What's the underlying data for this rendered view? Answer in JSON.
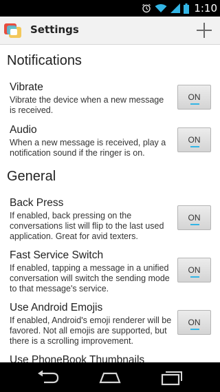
{
  "status_bar": {
    "time": "1:10",
    "icons": [
      "alarm-icon",
      "wifi-icon",
      "signal-icon",
      "battery-icon"
    ]
  },
  "action_bar": {
    "title": "Settings",
    "add_icon": "plus-icon"
  },
  "sections": [
    {
      "header": "Notifications",
      "items": [
        {
          "title": "Vibrate",
          "summary": "Vibrate the device when a new message is received.",
          "toggle": "ON"
        },
        {
          "title": "Audio",
          "summary": "When a new message is received, play a notification sound if the ringer is on.",
          "toggle": "ON"
        }
      ]
    },
    {
      "header": "General",
      "items": [
        {
          "title": "Back Press",
          "summary": "If enabled, back pressing on the conversations list will flip to the last used application. Great for avid texters.",
          "toggle": "ON"
        },
        {
          "title": "Fast Service Switch",
          "summary": "If enabled, tapping a message in a unified conversation will switch the sending mode to that message's service.",
          "toggle": "ON"
        },
        {
          "title": "Use Android Emojis",
          "summary": "If enabled, Android's emoji renderer will be favored. Not all emojis are supported, but there is a scrolling improvement.",
          "toggle": "ON"
        },
        {
          "title": "Use PhoneBook Thumbnails",
          "summary": "",
          "toggle": ""
        }
      ]
    }
  ],
  "nav_bar": {
    "icons": [
      "back-icon",
      "home-icon",
      "recent-apps-icon"
    ]
  },
  "colors": {
    "accent": "#33b5e5",
    "status_bar": "#000000",
    "action_bar": "#f2f2f2"
  }
}
